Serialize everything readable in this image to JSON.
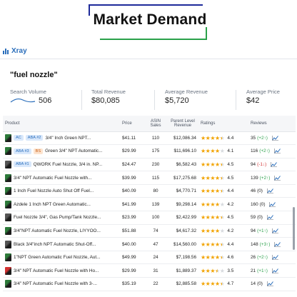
{
  "header": {
    "title": "Market Demand"
  },
  "app": {
    "name": "Xray"
  },
  "query": "\"fuel nozzle\"",
  "stats": {
    "search_volume_label": "Search Volume",
    "search_volume": "506",
    "total_revenue_label": "Total Revenue",
    "total_revenue": "$80,085",
    "avg_revenue_label": "Average Revenue",
    "avg_revenue": "$5,720",
    "avg_price_label": "Average Price",
    "avg_price": "$42"
  },
  "table": {
    "headers": {
      "product": "Product",
      "price": "Price",
      "asin_sales": "ASIN Sales",
      "parent_revenue": "Parent Level Revenue",
      "ratings": "Ratings",
      "reviews": "Reviews"
    },
    "rows": [
      {
        "badges": [
          {
            "text": "AC",
            "kind": "ac"
          },
          {
            "text": "ABA #2",
            "kind": "aba"
          }
        ],
        "name": "3/4\" Inch Green NPT...",
        "price": "$41.11",
        "sales": "110",
        "revenue": "$12,086.34",
        "rating": "4.4",
        "stars": 4.5,
        "reviews": "35",
        "delta": "(+2↑)",
        "dir": "up",
        "thumb": "g"
      },
      {
        "badges": [
          {
            "text": "ABA #3",
            "kind": "aba"
          },
          {
            "text": "BS",
            "kind": "bs"
          }
        ],
        "name": "Green 3/4\" NPT Automatic...",
        "price": "$29.99",
        "sales": "175",
        "revenue": "$11,696.10",
        "rating": "4.1",
        "stars": 4,
        "reviews": "116",
        "delta": "(+2↑)",
        "dir": "up",
        "thumb": "g"
      },
      {
        "badges": [
          {
            "text": "ABA #1",
            "kind": "aba"
          }
        ],
        "name": "QWORK Fuel Nozzle, 3/4 in. NP...",
        "price": "$24.47",
        "sales": "230",
        "revenue": "$6,582.43",
        "rating": "4.5",
        "stars": 4.5,
        "reviews": "94",
        "delta": "(-1↓)",
        "dir": "dn",
        "thumb": "k"
      },
      {
        "badges": [],
        "name": "3/4\" NPT Automatic Fuel Nozzle with...",
        "price": "$39.99",
        "sales": "115",
        "revenue": "$17,275.68",
        "rating": "4.5",
        "stars": 4.5,
        "reviews": "139",
        "delta": "(+2↑)",
        "dir": "up",
        "thumb": "g"
      },
      {
        "badges": [],
        "name": "1 Inch Fuel Nozzle Auto Shut Off Fuel...",
        "price": "$40.09",
        "sales": "80",
        "revenue": "$4,770.71",
        "rating": "4.4",
        "stars": 4.5,
        "reviews": "46",
        "delta": "(0)",
        "dir": "",
        "thumb": "g"
      },
      {
        "badges": [],
        "name": "Azdele 1 Inch NPT Green Automatic...",
        "price": "$41.99",
        "sales": "139",
        "revenue": "$9,298.14",
        "rating": "4.2",
        "stars": 4,
        "reviews": "160",
        "delta": "(0)",
        "dir": "",
        "thumb": "g"
      },
      {
        "badges": [],
        "name": "Fuel Nozzle 3/4\", Gas Pump/Tank Nozzle...",
        "price": "$23.99",
        "sales": "100",
        "revenue": "$2,422.99",
        "rating": "4.5",
        "stars": 4.5,
        "reviews": "59",
        "delta": "(0)",
        "dir": "",
        "thumb": "k"
      },
      {
        "badges": [],
        "name": "3/4\"NPT Automatic Fuel Nozzle, LIYYOO...",
        "price": "$51.88",
        "sales": "74",
        "revenue": "$4,617.32",
        "rating": "4.2",
        "stars": 4,
        "reviews": "94",
        "delta": "(+1↑)",
        "dir": "up",
        "thumb": "g"
      },
      {
        "badges": [],
        "name": "Black 3/4\"inch NPT Automatic Shut-Off...",
        "price": "$40.00",
        "sales": "47",
        "revenue": "$14,560.00",
        "rating": "4.4",
        "stars": 4.5,
        "reviews": "148",
        "delta": "(+3↑)",
        "dir": "up",
        "thumb": "k"
      },
      {
        "badges": [],
        "name": "1\"NPT Green Automatic Fuel Nozzle, Aut...",
        "price": "$49.99",
        "sales": "24",
        "revenue": "$7,198.56",
        "rating": "4.6",
        "stars": 4.5,
        "reviews": "26",
        "delta": "(+2↑)",
        "dir": "up",
        "thumb": "g"
      },
      {
        "badges": [],
        "name": "3/4\" NPT Automatic Fuel Nozzle with Ho...",
        "price": "$29.99",
        "sales": "31",
        "revenue": "$1,889.37",
        "rating": "3.5",
        "stars": 3.5,
        "reviews": "21",
        "delta": "(+1↑)",
        "dir": "up",
        "thumb": "r"
      },
      {
        "badges": [],
        "name": "3/4\" NPT Automatic Fuel Nozzle with 3-...",
        "price": "$35.19",
        "sales": "22",
        "revenue": "$2,885.58",
        "rating": "4.7",
        "stars": 4.5,
        "reviews": "14",
        "delta": "(0)",
        "dir": "",
        "thumb": "g"
      }
    ]
  }
}
